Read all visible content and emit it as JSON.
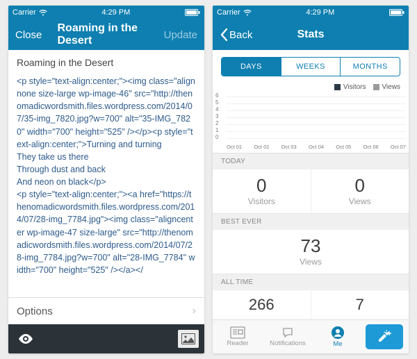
{
  "statusbar": {
    "carrier": "Carrier",
    "time": "4:29 PM"
  },
  "left": {
    "nav": {
      "close": "Close",
      "title": "Roaming in the Desert",
      "update": "Update"
    },
    "post_title": "Roaming in the Desert",
    "html_source": "<p style=\"text-align:center;\"><img class=\"alignnone size-large wp-image-46\" src=\"http://thenomadicwordsmith.files.wordpress.com/2014/07/35-img_7820.jpg?w=700\" alt=\"35-IMG_7820\" width=\"700\" height=\"525\" /></p><p style=\"text-align:center;\">Turning and turning\nThey take us there\nThrough dust and back\nAnd neon on black</p>\n<p style=\"text-align:center;\"><a href=\"https://thenomadicwordsmith.files.wordpress.com/2014/07/28-img_7784.jpg\"><img class=\"aligncenter wp-image-47 size-large\" src=\"http://thenomadicwordsmith.files.wordpress.com/2014/07/28-img_7784.jpg?w=700\" alt=\"28-IMG_7784\" width=\"700\" height=\"525\" /></a></",
    "options": "Options"
  },
  "right": {
    "nav": {
      "back": "Back",
      "title": "Stats"
    },
    "segments": [
      "DAYS",
      "WEEKS",
      "MONTHS"
    ],
    "legend": {
      "visitors": "Visitors",
      "views": "Views"
    },
    "sections": {
      "today": "TODAY",
      "best": "BEST EVER",
      "all": "ALL TIME"
    },
    "stats": {
      "today_visitors": "0",
      "today_views": "0",
      "best_views": "73",
      "all_visitors": "266",
      "all_views": "7"
    },
    "labels": {
      "visitors": "Visitors",
      "views": "Views"
    },
    "tabs": {
      "reader": "Reader",
      "notifications": "Notifications",
      "me": "Me"
    }
  },
  "chart_data": {
    "type": "bar",
    "categories": [
      "Oct 01",
      "Oct 02",
      "Oct 03",
      "Oct 04",
      "Oct 05",
      "Oct 06",
      "Oct 07"
    ],
    "series": [
      {
        "name": "Visitors",
        "color": "#2d3a45",
        "values": [
          0,
          0,
          0,
          0,
          0,
          0,
          0
        ]
      },
      {
        "name": "Views",
        "color": "#9a9a9a",
        "values": [
          0,
          0,
          0,
          0,
          0,
          0,
          0
        ]
      }
    ],
    "yticks": [
      0,
      1,
      2,
      3,
      4,
      5,
      6
    ],
    "ylim": [
      0,
      6
    ]
  }
}
